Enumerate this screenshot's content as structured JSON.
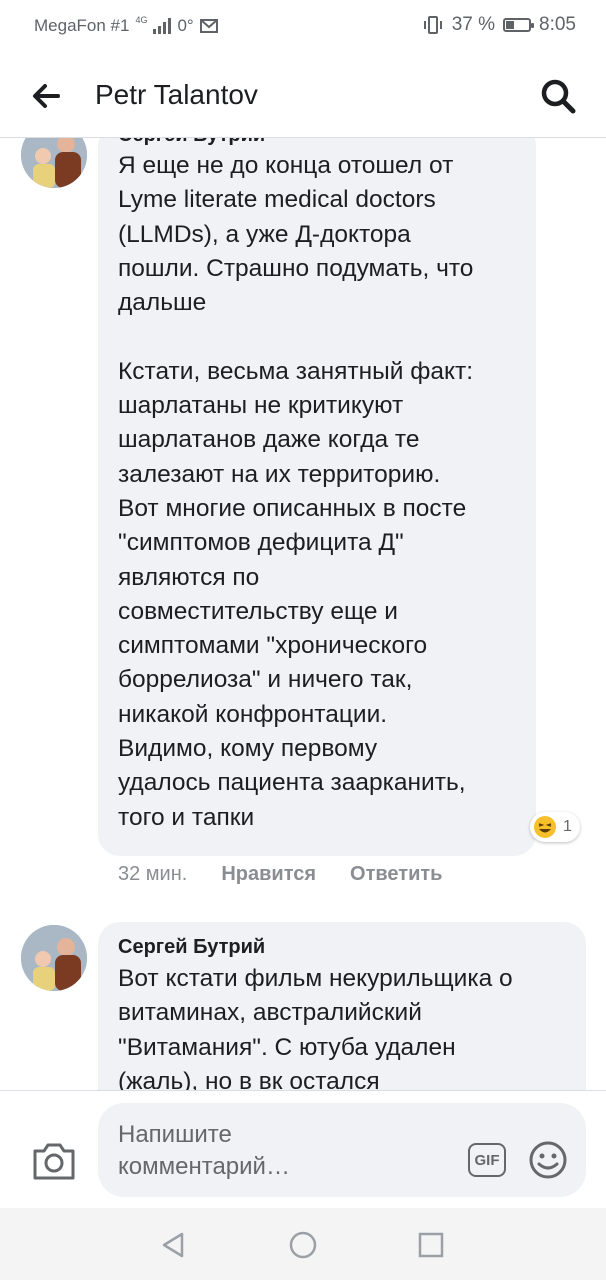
{
  "status_bar": {
    "carrier": "MegaFon #1",
    "network": "4G",
    "data_counter": "0°",
    "vibrate_icon": "vibrate-icon",
    "battery_percent": "37 %",
    "battery_level": 0.37,
    "time": "8:05"
  },
  "header": {
    "back_icon": "arrow-left-icon",
    "title": "Petr Talantov",
    "search_icon": "search-icon"
  },
  "comments": [
    {
      "author": "Сергей Бутрий",
      "text": "Я еще не до конца отошел от\nLyme literate medical doctors\n(LLMDs), а уже Д-доктора\nпошли. Страшно подумать, что\nдальше\n\nКстати, весьма занятный факт:\nшарлатаны не критикуют\nшарлатанов даже когда те\nзалезают на их территорию.\nВот многие описанных в посте\n\"симптомов дефицита Д\"\nявляются по\nсовместительству еще и\nсимптомами \"хронического\nборрелиоза\" и ничего так,\nникакой конфронтации.\nВидимо, кому первому\nудалось пациента заарканить,\nтого и тапки",
      "reaction_icon": "laughing-emoji-icon",
      "reaction_count": "1",
      "time": "32 мин.",
      "like_label": "Нравится",
      "reply_label": "Ответить"
    },
    {
      "author": "Сергей Бутрий",
      "text": "Вот кстати фильм некурильщика о\nвитаминах, австралийский\n\"Витамания\". С ютуба удален\n(жаль), но в вк остался"
    }
  ],
  "composer": {
    "camera_icon": "camera-icon",
    "placeholder": "Напишите комментарий…",
    "gif_label": "GIF",
    "emoji_icon": "smiley-icon"
  },
  "nav_bar": {
    "back_icon": "triangle-back-icon",
    "home_icon": "circle-home-icon",
    "recent_icon": "square-recent-icon"
  },
  "colors": {
    "bubble": "#f0f2f5",
    "text": "#1c1e21",
    "secondary": "#8a8d91"
  }
}
